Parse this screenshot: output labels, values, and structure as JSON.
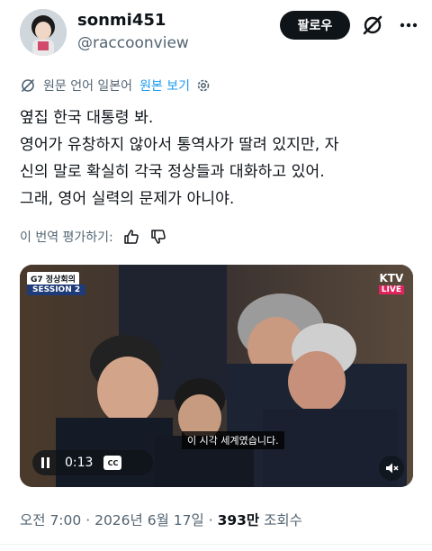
{
  "user": {
    "display_name": "sonmi451",
    "handle": "@raccoonview",
    "avatar_icon": "avatar-photo"
  },
  "header": {
    "follow_label": "팔로우",
    "grok_icon": "grok-icon",
    "more_icon": "more-icon"
  },
  "translation": {
    "notice": "원문 언어 일본어",
    "show_original": "원본 보기",
    "translate_icon": "translate-icon",
    "settings_icon": "gear-icon",
    "link_color": "#1d9bf0"
  },
  "tweet": {
    "lines": [
      "옆집 한국 대통령 봐.",
      "영어가 유창하지 않아서 통역사가 딸려 있지만, 자",
      "신의 말로 확실히 각국 정상들과 대화하고 있어.",
      "그래, 영어 실력의 문제가 아니야."
    ]
  },
  "rate": {
    "label": "이 번역 평가하기:",
    "thumbs_up_icon": "thumbs-up-icon",
    "thumbs_down_icon": "thumbs-down-icon"
  },
  "video": {
    "top_left_title": "G7 정상회의",
    "session_label": "SESSION 2",
    "broadcaster": "KTV",
    "live_label": "LIVE",
    "subtitle": "이 시각 세계였습니다.",
    "time": "0:13",
    "cc_label": "CC",
    "pause_icon": "pause-icon",
    "mute_icon": "mute-icon",
    "live_color": "#e0245e"
  },
  "meta": {
    "time": "오전 7:00",
    "date": "2026년 6월 17일",
    "separator": "·",
    "views_count": "393만",
    "views_label": "조회수"
  }
}
